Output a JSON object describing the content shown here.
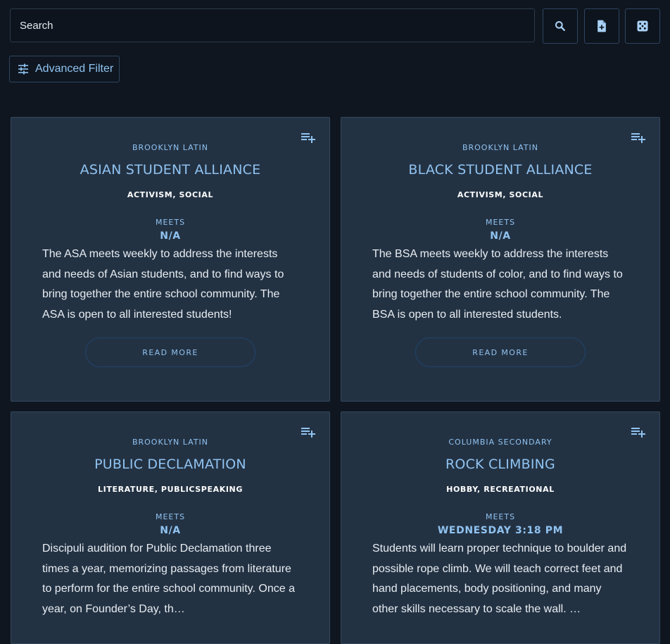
{
  "search": {
    "placeholder": "Search",
    "value": ""
  },
  "toolbar": {
    "search_icon": "search-icon",
    "add_file_icon": "file-plus-icon",
    "random_icon": "dice-icon",
    "advanced_filter_label": "Advanced Filter",
    "filter_icon": "sliders-icon"
  },
  "colors": {
    "background": "#0f1620",
    "card": "#233243",
    "accent": "#90c3f1"
  },
  "cards": [
    {
      "school": "BROOKLYN LATIN",
      "title": "ASIAN STUDENT ALLIANCE",
      "tags": "ACTIVISM, SOCIAL",
      "meets_label": "MEETS",
      "meets_value": "N/A",
      "description": "The ASA meets weekly to address the interests and needs of Asian students, and to find ways to bring together the entire school community. The ASA is open to all interested students!",
      "read_more": "READ MORE"
    },
    {
      "school": "BROOKLYN LATIN",
      "title": "BLACK STUDENT ALLIANCE",
      "tags": "ACTIVISM, SOCIAL",
      "meets_label": "MEETS",
      "meets_value": "N/A",
      "description": "The BSA meets weekly to address the interests and needs of students of color, and to find ways to bring together the entire school community. The BSA is open to all interested students.",
      "read_more": "READ MORE"
    },
    {
      "school": "BROOKLYN LATIN",
      "title": "PUBLIC DECLAMATION",
      "tags": "LITERATURE, PUBLICSPEAKING",
      "meets_label": "MEETS",
      "meets_value": "N/A",
      "description": "Discipuli audition for Public Declamation three times a year, memorizing passages from literature to perform for the entire school community. Once a year, on Founder’s Day, th…",
      "read_more": "READ MORE"
    },
    {
      "school": "COLUMBIA SECONDARY",
      "title": "ROCK CLIMBING",
      "tags": "HOBBY, RECREATIONAL",
      "meets_label": "MEETS",
      "meets_value": "WEDNESDAY 3:18 PM",
      "description": "Students will learn proper technique to boulder and possible rope climb. We will teach correct feet and hand placements, body positioning, and many other skills necessary to scale the wall. …",
      "read_more": "READ MORE"
    }
  ]
}
